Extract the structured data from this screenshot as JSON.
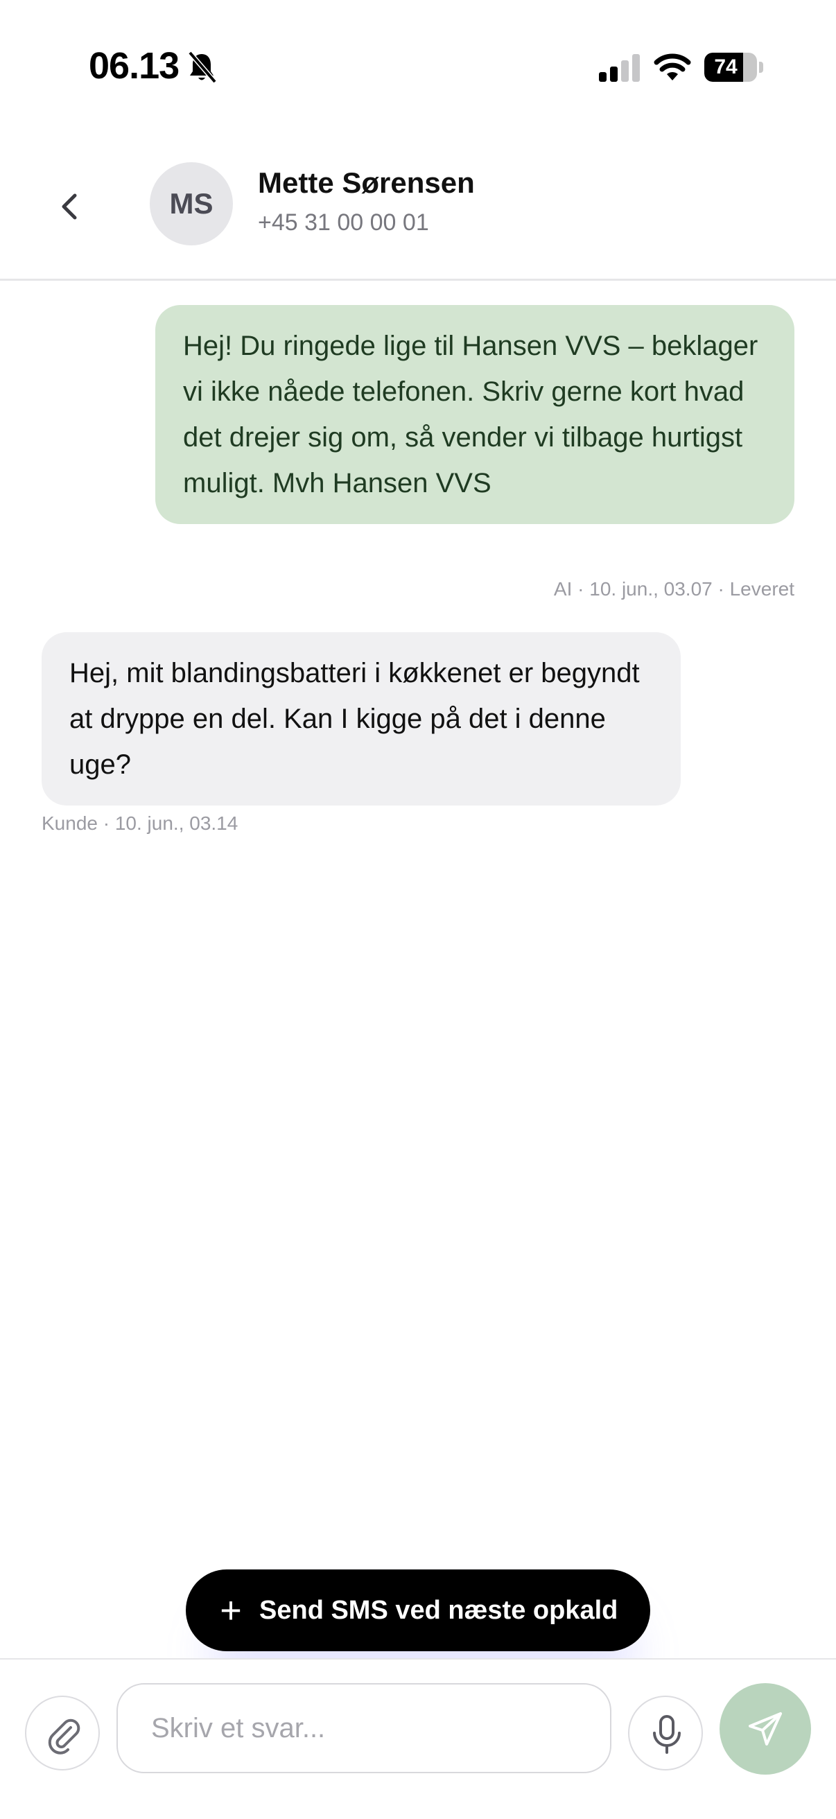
{
  "status_bar": {
    "time": "06.13",
    "battery": "74",
    "battery_level": 0.74,
    "icons": [
      "bell-slash-icon",
      "signal-icon",
      "wifi-icon",
      "battery-icon"
    ]
  },
  "contact": {
    "initials": "MS",
    "name": "Mette Sørensen",
    "phone": "+45 31 00 00 01"
  },
  "messages": [
    {
      "direction": "outgoing",
      "text": "Hej! Du ringede lige til Hansen VVS – beklager vi ikke nåede telefonen. Skriv gerne kort hvad det drejer sig om, så vender vi tilbage hurtigst muligt. Mvh Hansen VVS",
      "meta": "AI · 10. jun., 03.07 · Leveret"
    },
    {
      "direction": "incoming",
      "text": "Hej, mit blandingsbatteri i køkkenet er begyndt at dryppe en del. Kan I kigge på det i denne uge?",
      "meta": "Kunde · 10. jun., 03.14"
    }
  ],
  "action_pill": {
    "icon": "plus-icon",
    "label": "Send SMS ved næste opkald"
  },
  "composer": {
    "placeholder": "Skriv et svar...",
    "value": "",
    "attach_icon": "paperclip-icon",
    "mic_icon": "microphone-icon",
    "send_icon": "send-icon"
  },
  "colors": {
    "outgoing_bubble": "#d3e5d1",
    "incoming_bubble": "#f0f0f2",
    "send_button": "#b9d4bd",
    "pill": "#000000"
  }
}
